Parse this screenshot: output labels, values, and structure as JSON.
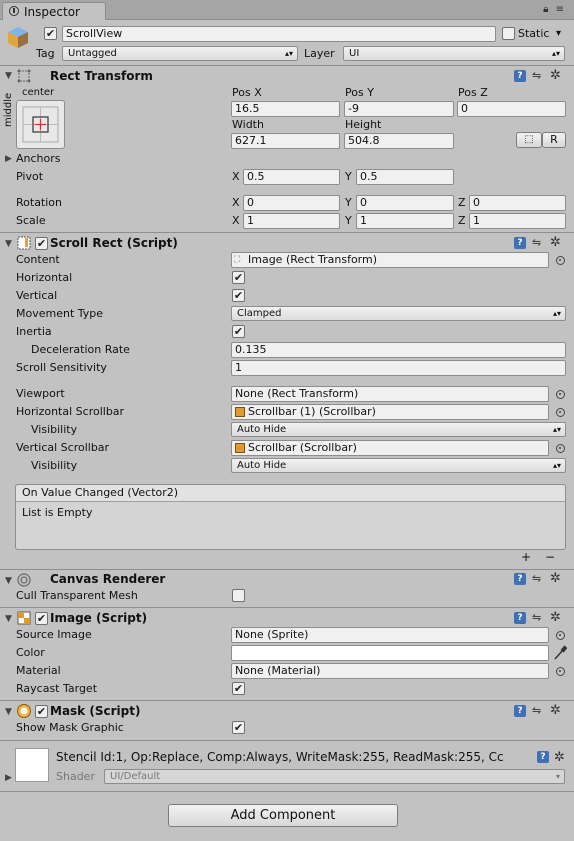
{
  "tab": {
    "title": "Inspector",
    "icons": "lock-icon, menu-icon"
  },
  "gameobject": {
    "active": true,
    "name": "ScrollView",
    "static_label": "Static",
    "static": false,
    "tag_label": "Tag",
    "tag": "Untagged",
    "layer_label": "Layer",
    "layer": "UI"
  },
  "rect_transform": {
    "title": "Rect Transform",
    "anchor_h": "center",
    "anchor_v": "middle",
    "pos_x_label": "Pos X",
    "pos_y_label": "Pos Y",
    "pos_z_label": "Pos Z",
    "pos_x": "16.5",
    "pos_y": "-9",
    "pos_z": "0",
    "width_label": "Width",
    "height_label": "Height",
    "width": "627.1",
    "height": "504.8",
    "raw_button": "R",
    "anchors_label": "Anchors",
    "pivot_label": "Pivot",
    "pivot_x": "0.5",
    "pivot_y": "0.5",
    "rotation_label": "Rotation",
    "rot_x": "0",
    "rot_y": "0",
    "rot_z": "0",
    "scale_label": "Scale",
    "scale_x": "1",
    "scale_y": "1",
    "scale_z": "1",
    "x": "X",
    "y": "Y",
    "z": "Z"
  },
  "scroll_rect": {
    "title": "Scroll Rect (Script)",
    "content_label": "Content",
    "content": "Image (Rect Transform)",
    "horizontal_label": "Horizontal",
    "horizontal": true,
    "vertical_label": "Vertical",
    "vertical": true,
    "movement_label": "Movement Type",
    "movement": "Clamped",
    "inertia_label": "Inertia",
    "inertia": true,
    "decel_label": "Deceleration Rate",
    "decel": "0.135",
    "sensitivity_label": "Scroll Sensitivity",
    "sensitivity": "1",
    "viewport_label": "Viewport",
    "viewport": "None (Rect Transform)",
    "hscroll_label": "Horizontal Scrollbar",
    "hscroll": "Scrollbar (1) (Scrollbar)",
    "hvis_label": "Visibility",
    "hvis": "Auto Hide",
    "vscroll_label": "Vertical Scrollbar",
    "vscroll": "Scrollbar (Scrollbar)",
    "vvis_label": "Visibility",
    "vvis": "Auto Hide",
    "event_title": "On Value Changed (Vector2)",
    "event_empty": "List is Empty",
    "add": "+",
    "remove": "−"
  },
  "canvas_renderer": {
    "title": "Canvas Renderer",
    "cull_label": "Cull Transparent Mesh",
    "cull": false
  },
  "image": {
    "title": "Image (Script)",
    "source_label": "Source Image",
    "source": "None (Sprite)",
    "color_label": "Color",
    "color": "#ffffff",
    "material_label": "Material",
    "material": "None (Material)",
    "raycast_label": "Raycast Target",
    "raycast": true
  },
  "mask": {
    "title": "Mask (Script)",
    "show_label": "Show Mask Graphic",
    "show": true
  },
  "material_section": {
    "title": "Stencil Id:1, Op:Replace, Comp:Always, WriteMask:255, ReadMask:255, Cc",
    "shader_label": "Shader",
    "shader": "UI/Default"
  },
  "add_component": "Add Component",
  "check_glyph": "✔"
}
